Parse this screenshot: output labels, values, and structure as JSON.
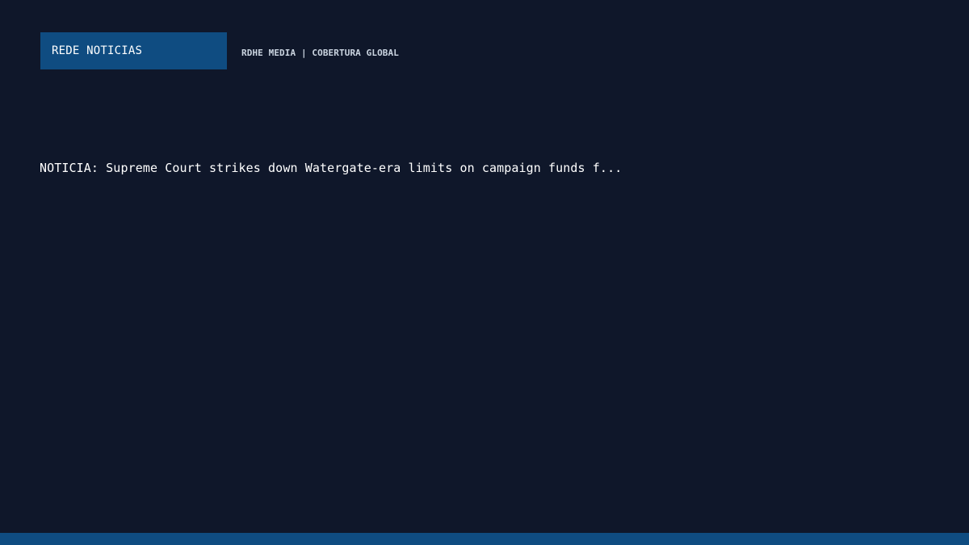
{
  "header": {
    "brand": "REDE NOTICIAS",
    "tagline": "RDHE MEDIA | COBERTURA GLOBAL"
  },
  "story": {
    "headline": "NOTICIA: Supreme Court strikes down Watergate-era limits on campaign funds f..."
  },
  "colors": {
    "background": "#0f172a",
    "accent": "#0f4c81",
    "text": "#ffffff",
    "muted_text": "#cbd5e1"
  }
}
